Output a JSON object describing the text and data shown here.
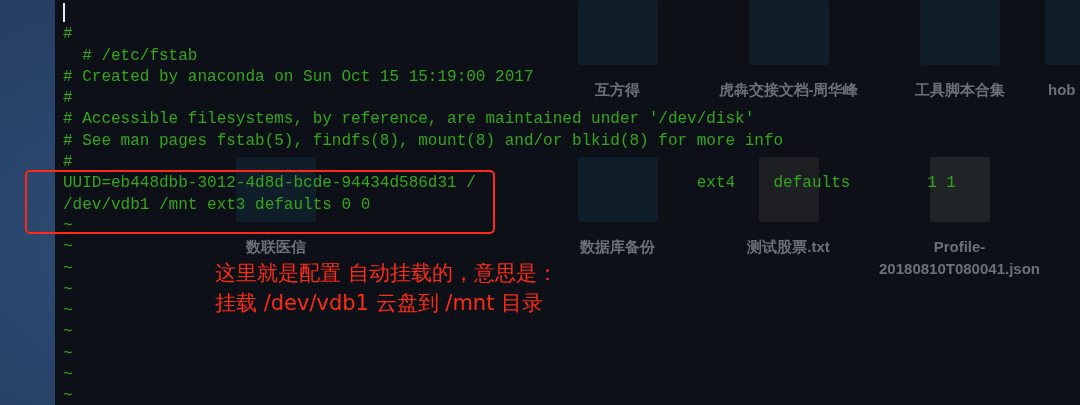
{
  "desktop": {
    "rows": [
      [
        {
          "kind": "blank"
        },
        {
          "kind": "blank"
        },
        {
          "kind": "blank"
        },
        {
          "kind": "folder",
          "label": "互方得"
        },
        {
          "kind": "folder",
          "label": "虎犇交接文档-周华峰"
        },
        {
          "kind": "folder",
          "label": "工具脚本合集"
        },
        {
          "kind": "folder",
          "label": "hob"
        }
      ],
      [
        {
          "kind": "blank"
        },
        {
          "kind": "folder",
          "label": "数联医信"
        },
        {
          "kind": "blank"
        },
        {
          "kind": "folder",
          "label": "数据库备份"
        },
        {
          "kind": "document",
          "label": "测试股票.txt"
        },
        {
          "kind": "code-file",
          "label": "Profile-20180810T080041.json"
        }
      ]
    ]
  },
  "terminal": {
    "lines": [
      {
        "kind": "cursor"
      },
      {
        "kind": "text",
        "text": "#"
      },
      {
        "kind": "text",
        "text": "  # /etc/fstab"
      },
      {
        "kind": "text",
        "text": "# Created by anaconda on Sun Oct 15 15:19:00 2017"
      },
      {
        "kind": "text",
        "text": "#"
      },
      {
        "kind": "text",
        "text": "# Accessible filesystems, by reference, are maintained under '/dev/disk'"
      },
      {
        "kind": "text",
        "text": "# See man pages fstab(5), findfs(8), mount(8) and/or blkid(8) for more info"
      },
      {
        "kind": "text",
        "text": "#"
      },
      {
        "kind": "text",
        "text": "UUID=eb448dbb-3012-4d8d-bcde-94434d586d31 /                       ext4    defaults        1 1"
      },
      {
        "kind": "text",
        "text": "/dev/vdb1 /mnt ext3 defaults 0 0"
      },
      {
        "kind": "tilde",
        "text": "~"
      },
      {
        "kind": "tilde",
        "text": "~"
      },
      {
        "kind": "tilde",
        "text": "~"
      },
      {
        "kind": "tilde",
        "text": "~"
      },
      {
        "kind": "tilde",
        "text": "~"
      },
      {
        "kind": "tilde",
        "text": "~"
      },
      {
        "kind": "tilde",
        "text": "~"
      },
      {
        "kind": "tilde",
        "text": "~"
      },
      {
        "kind": "tilde",
        "text": "~"
      }
    ]
  },
  "annotation": {
    "lines": [
      "这里就是配置 自动挂载的，意思是：",
      "挂载 /dev/vdb1 云盘到 /mnt 目录"
    ]
  }
}
